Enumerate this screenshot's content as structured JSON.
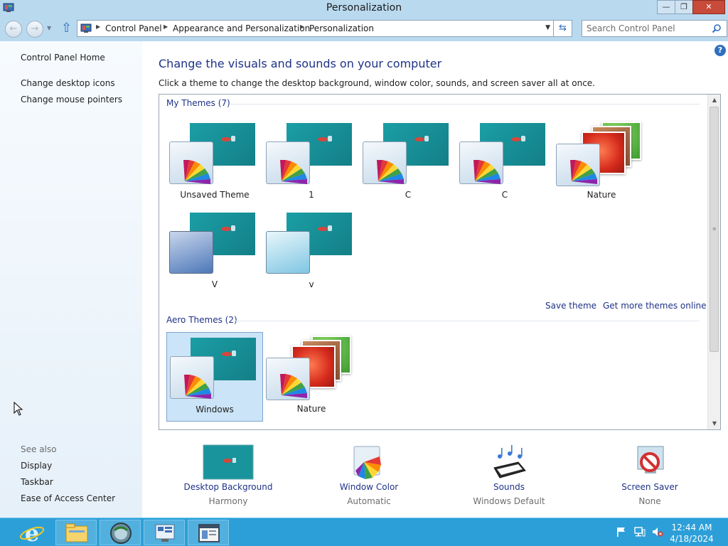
{
  "window": {
    "title": "Personalization",
    "minimize_glyph": "—",
    "maximize_glyph": "❐",
    "close_glyph": "✕"
  },
  "navbar": {
    "back_glyph": "←",
    "forward_glyph": "→",
    "up_glyph": "⇧",
    "breadcrumbs": [
      "Control Panel",
      "Appearance and Personalization",
      "Personalization"
    ],
    "search_placeholder": "Search Control Panel"
  },
  "left_pane": {
    "home_link": "Control Panel Home",
    "links": [
      "Change desktop icons",
      "Change mouse pointers"
    ],
    "see_also_label": "See also",
    "see_also_links": [
      "Display",
      "Taskbar",
      "Ease of Access Center"
    ]
  },
  "main": {
    "help_glyph": "?",
    "heading": "Change the visuals and sounds on your computer",
    "subtext": "Click a theme to change the desktop background, window color, sounds, and screen saver all at once.",
    "my_themes_label": "My Themes (7)",
    "my_themes": [
      {
        "name": "Unsaved Theme",
        "kind": "standard"
      },
      {
        "name": "1",
        "kind": "standard"
      },
      {
        "name": "C",
        "kind": "standard"
      },
      {
        "name": "C",
        "kind": "standard"
      },
      {
        "name": "Nature",
        "kind": "nature"
      },
      {
        "name": "V",
        "kind": "dark"
      },
      {
        "name": "v",
        "kind": "light"
      }
    ],
    "save_theme_link": "Save theme",
    "get_more_link": "Get more themes online",
    "aero_themes_label": "Aero Themes (2)",
    "aero_themes": [
      {
        "name": "Windows",
        "kind": "standard",
        "selected": true
      },
      {
        "name": "Nature",
        "kind": "nature",
        "selected": false
      }
    ]
  },
  "settings": [
    {
      "label": "Desktop Background",
      "value": "Harmony",
      "icon": "desktop-background-icon"
    },
    {
      "label": "Window Color",
      "value": "Automatic",
      "icon": "window-color-icon"
    },
    {
      "label": "Sounds",
      "value": "Windows Default",
      "icon": "sounds-icon"
    },
    {
      "label": "Screen Saver",
      "value": "None",
      "icon": "screen-saver-icon"
    }
  ],
  "taskbar": {
    "apps": [
      "internet-explorer-icon",
      "file-explorer-icon",
      "network-globe-icon",
      "control-panel-icon",
      "personalization-window-icon"
    ],
    "tray": [
      "action-center-flag-icon",
      "network-icon",
      "volume-muted-icon"
    ],
    "time": "12:44 AM",
    "date": "4/18/2024"
  },
  "colors": {
    "titlebar": "#b9d9ef",
    "taskbar": "#2d9fd8",
    "link_blue": "#1e3287",
    "selected_bg": "#cce4f7"
  }
}
